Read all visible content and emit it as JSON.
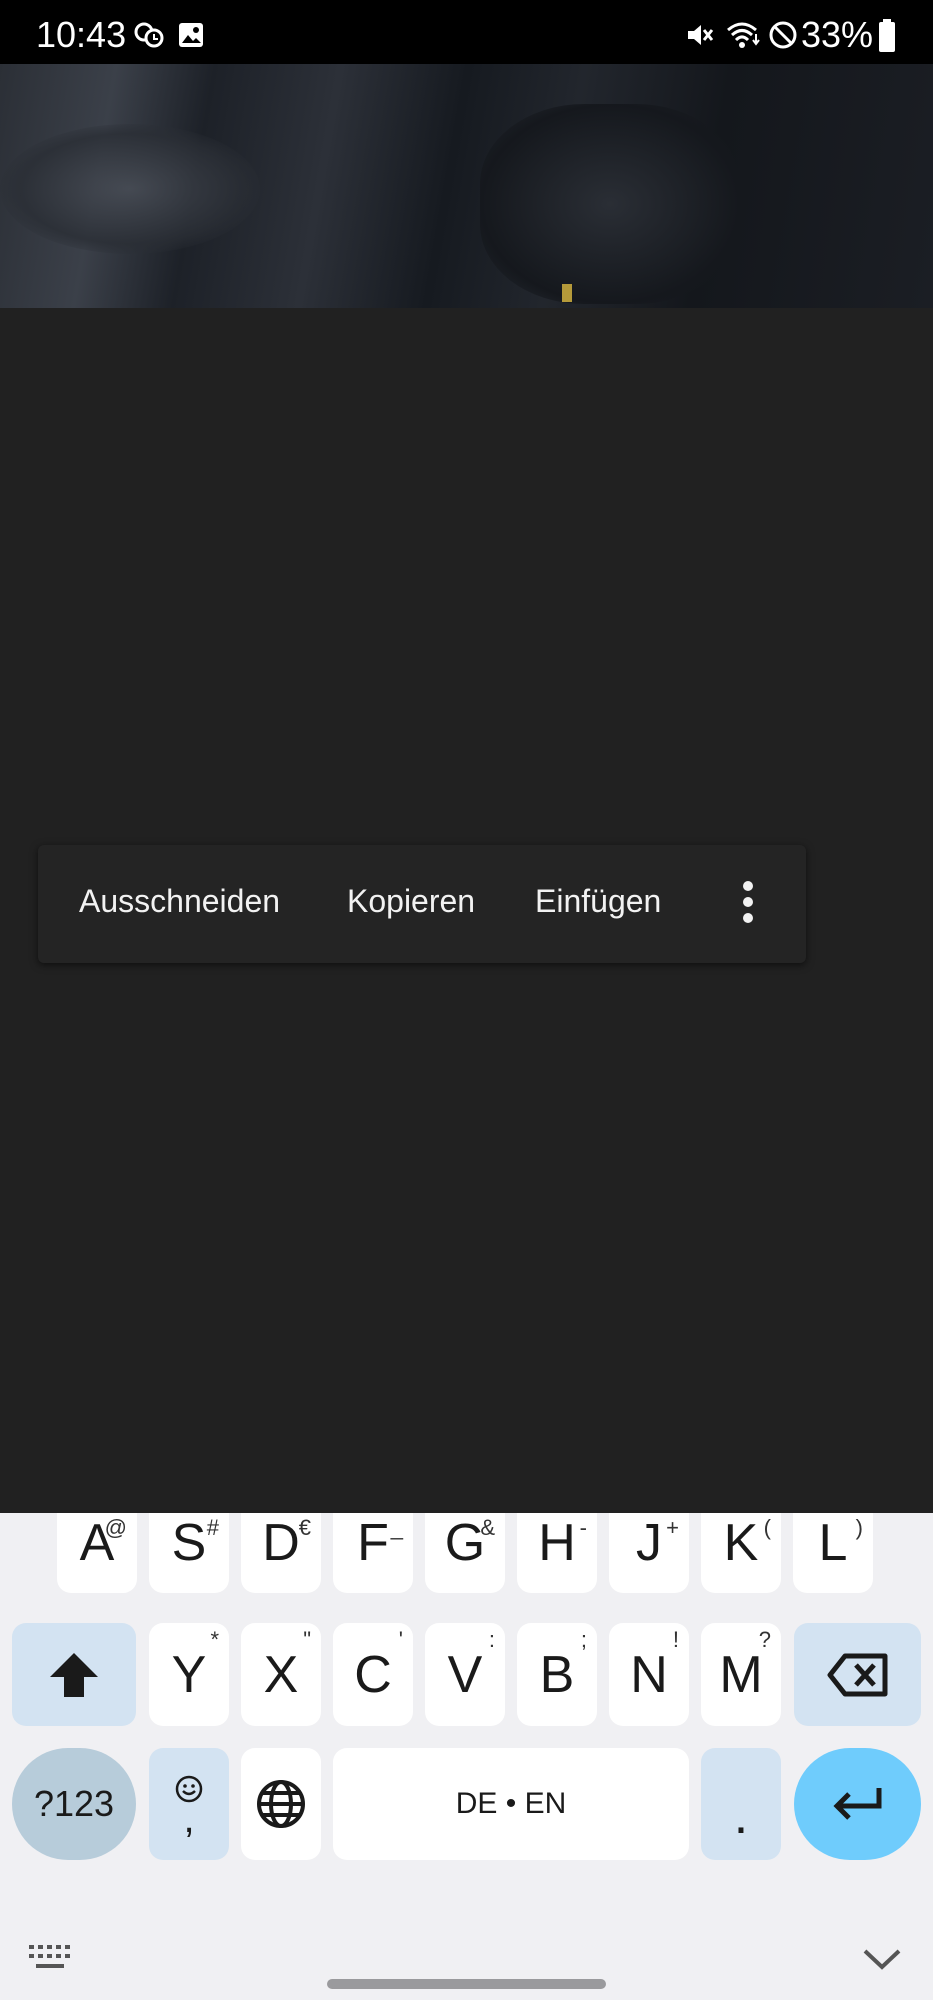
{
  "status_bar": {
    "time": "10:43",
    "battery": "33%"
  },
  "selection_toolbar": {
    "cut": "Ausschneiden",
    "copy": "Kopieren",
    "paste": "Einfügen"
  },
  "keyboard": {
    "row2": [
      {
        "label": "A",
        "hint": "@"
      },
      {
        "label": "S",
        "hint": "#"
      },
      {
        "label": "D",
        "hint": "€"
      },
      {
        "label": "F",
        "hint": "_"
      },
      {
        "label": "G",
        "hint": "&"
      },
      {
        "label": "H",
        "hint": "-"
      },
      {
        "label": "J",
        "hint": "+"
      },
      {
        "label": "K",
        "hint": "("
      },
      {
        "label": "L",
        "hint": ")"
      }
    ],
    "row3": [
      {
        "label": "Y",
        "hint": "*"
      },
      {
        "label": "X",
        "hint": "\""
      },
      {
        "label": "C",
        "hint": "'"
      },
      {
        "label": "V",
        "hint": ":"
      },
      {
        "label": "B",
        "hint": ";"
      },
      {
        "label": "N",
        "hint": "!"
      },
      {
        "label": "M",
        "hint": "?"
      }
    ],
    "symbols_key": "?123",
    "comma_key": ",",
    "space_label": "DE • EN",
    "period_key": "."
  },
  "colors": {
    "background": "#212121",
    "keyboard_bg": "#f0f0f3",
    "key": "#ffffff",
    "special_key": "#d3e3f2",
    "enter_key": "#6fccfc"
  },
  "icons": [
    "notification-icon",
    "gallery-icon",
    "mute-icon",
    "wifi-icon",
    "do-not-disturb-icon",
    "battery-icon",
    "shift-icon",
    "backspace-icon",
    "emoji-icon",
    "globe-icon",
    "enter-icon",
    "keyboard-icon",
    "chevron-down-icon",
    "more-vert-icon"
  ]
}
